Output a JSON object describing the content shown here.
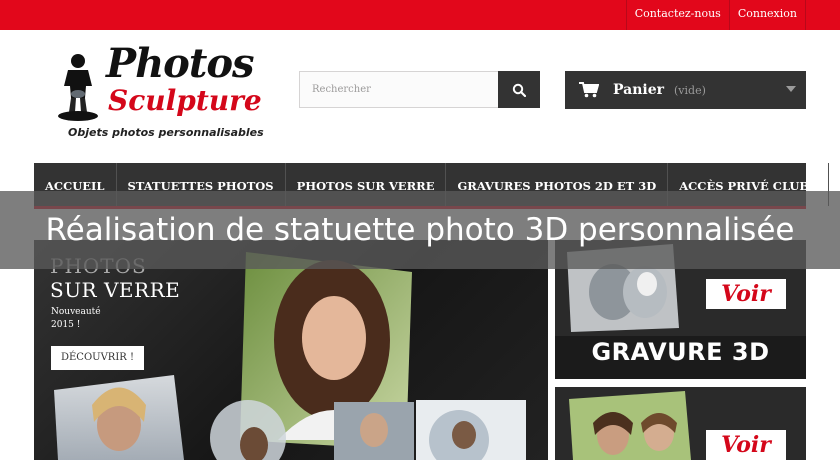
{
  "topbar": {
    "contact_label": "Contactez-nous",
    "login_label": "Connexion",
    "color": "#e2071b"
  },
  "logo": {
    "line1": "Photos",
    "line2": "Sculpture",
    "tagline": "Objets photos personnalisables"
  },
  "search": {
    "placeholder": "Rechercher",
    "button_icon": "search-icon"
  },
  "cart": {
    "label": "Panier",
    "status": "(vide)",
    "icon": "cart-icon"
  },
  "nav": {
    "items": [
      {
        "label": "ACCUEIL"
      },
      {
        "label": "STATUETTES PHOTOS"
      },
      {
        "label": "PHOTOS SUR VERRE"
      },
      {
        "label": "GRAVURES PHOTOS 2D ET 3D"
      },
      {
        "label": "ACCÈS PRIVÉ CLUBS"
      }
    ]
  },
  "overlay": {
    "headline": "Réalisation de statuette photo 3D personnalisée"
  },
  "slider": {
    "title_line1": "PHOTOS",
    "title_line2": "SUR VERRE",
    "note": "Nouveauté 2015 !",
    "cta_label": "DÉCOUVRIR !"
  },
  "promos": [
    {
      "button_label": "Voir",
      "caption": "GRAVURE 3D"
    },
    {
      "button_label": "Voir"
    }
  ]
}
